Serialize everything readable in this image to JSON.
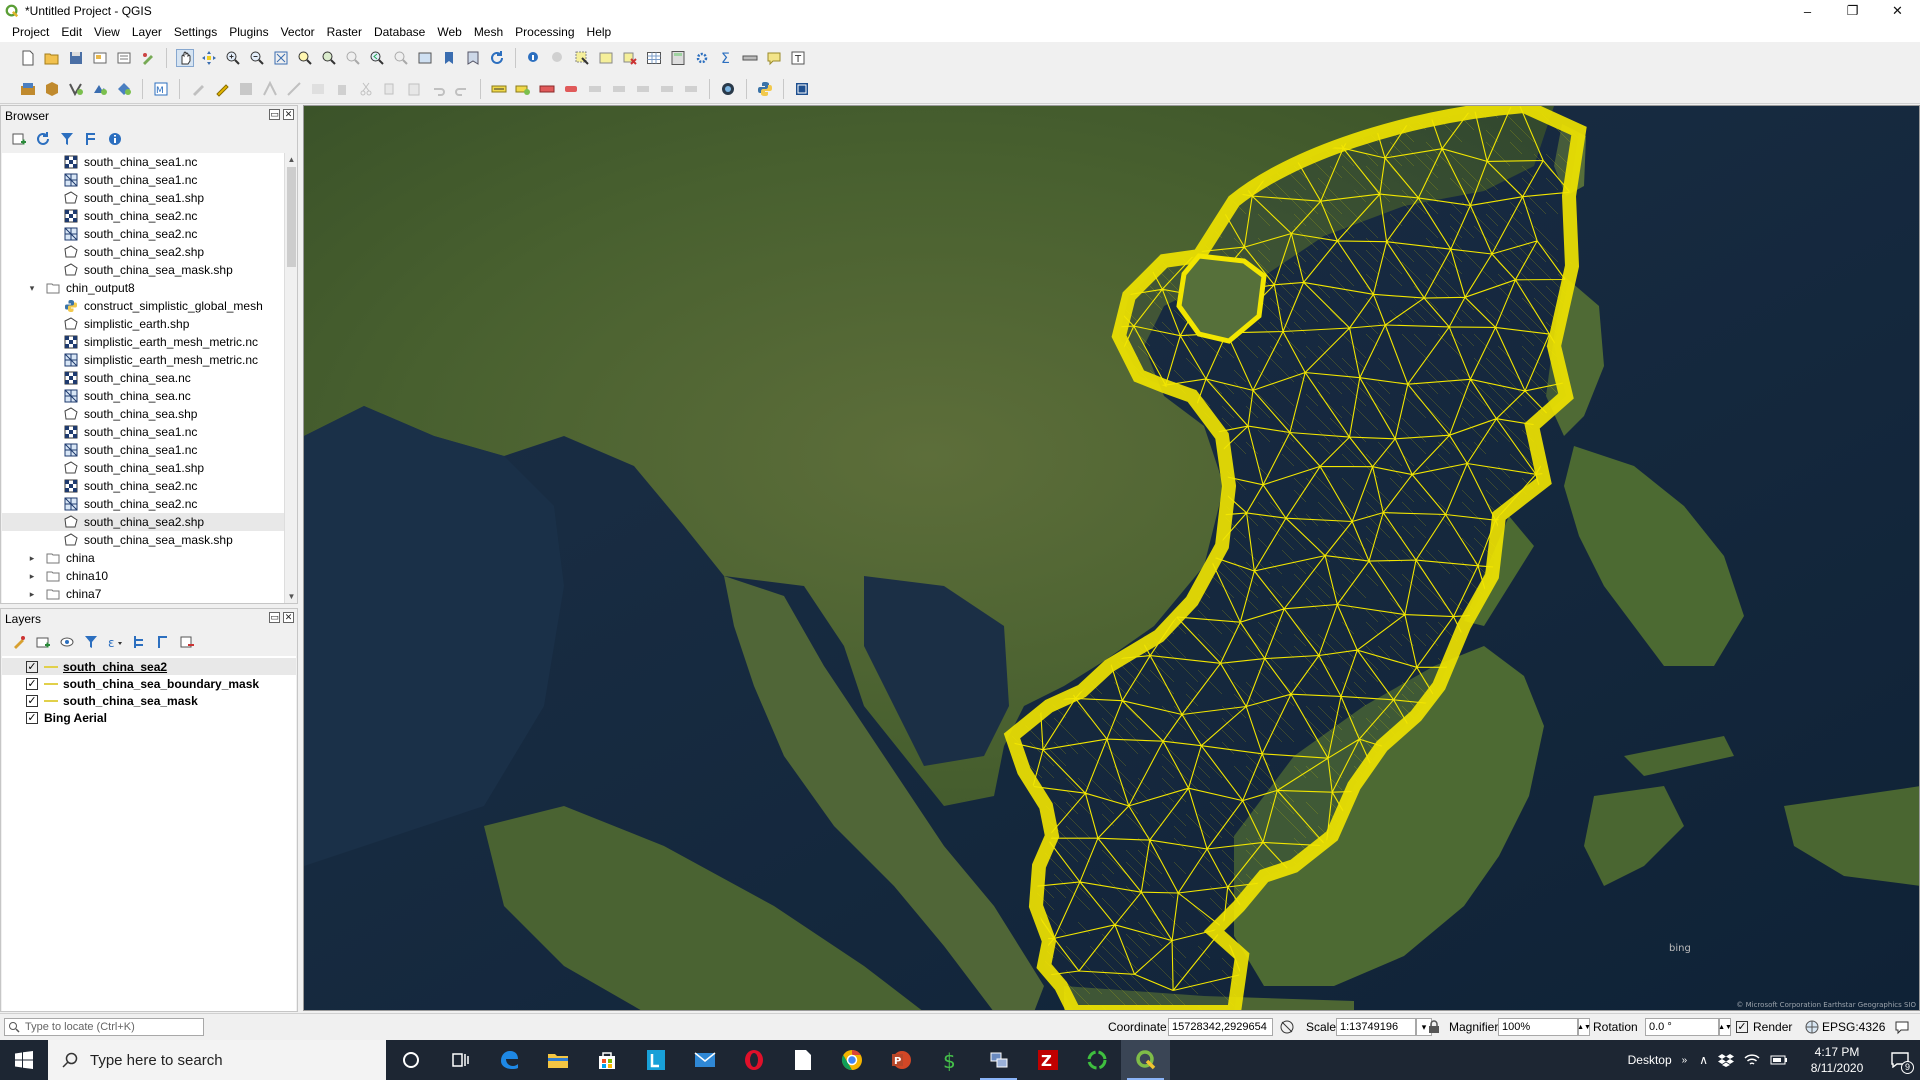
{
  "window": {
    "title": "*Untitled Project - QGIS",
    "minimize": "–",
    "maximize": "❐",
    "close": "✕"
  },
  "menu": [
    "Project",
    "Edit",
    "View",
    "Layer",
    "Settings",
    "Plugins",
    "Vector",
    "Raster",
    "Database",
    "Web",
    "Mesh",
    "Processing",
    "Help"
  ],
  "browser": {
    "title": "Browser",
    "items": [
      {
        "label": "south_china_sea1.nc",
        "icon": "raster-grid-icon",
        "expand": ""
      },
      {
        "label": "south_china_sea1.nc",
        "icon": "mesh-icon",
        "expand": ""
      },
      {
        "label": "south_china_sea1.shp",
        "icon": "polygon-layer-icon",
        "expand": ""
      },
      {
        "label": "south_china_sea2.nc",
        "icon": "raster-grid-icon",
        "expand": ""
      },
      {
        "label": "south_china_sea2.nc",
        "icon": "mesh-icon",
        "expand": ""
      },
      {
        "label": "south_china_sea2.shp",
        "icon": "polygon-layer-icon",
        "expand": ""
      },
      {
        "label": "south_china_sea_mask.shp",
        "icon": "polygon-layer-icon",
        "expand": ""
      },
      {
        "label": "chin_output8",
        "icon": "folder-icon",
        "expand": "▾"
      },
      {
        "label": "construct_simplistic_global_mesh",
        "icon": "python-file-icon",
        "expand": ""
      },
      {
        "label": "simplistic_earth.shp",
        "icon": "polygon-layer-icon",
        "expand": ""
      },
      {
        "label": "simplistic_earth_mesh_metric.nc",
        "icon": "raster-grid-icon",
        "expand": ""
      },
      {
        "label": "simplistic_earth_mesh_metric.nc",
        "icon": "mesh-icon",
        "expand": ""
      },
      {
        "label": "south_china_sea.nc",
        "icon": "raster-grid-icon",
        "expand": ""
      },
      {
        "label": "south_china_sea.nc",
        "icon": "mesh-icon",
        "expand": ""
      },
      {
        "label": "south_china_sea.shp",
        "icon": "polygon-layer-icon",
        "expand": ""
      },
      {
        "label": "south_china_sea1.nc",
        "icon": "raster-grid-icon",
        "expand": ""
      },
      {
        "label": "south_china_sea1.nc",
        "icon": "mesh-icon",
        "expand": ""
      },
      {
        "label": "south_china_sea1.shp",
        "icon": "polygon-layer-icon",
        "expand": ""
      },
      {
        "label": "south_china_sea2.nc",
        "icon": "raster-grid-icon",
        "expand": ""
      },
      {
        "label": "south_china_sea2.nc",
        "icon": "mesh-icon",
        "expand": ""
      },
      {
        "label": "south_china_sea2.shp",
        "icon": "polygon-layer-icon",
        "expand": "",
        "selected": true
      },
      {
        "label": "south_china_sea_mask.shp",
        "icon": "polygon-layer-icon",
        "expand": ""
      },
      {
        "label": "china",
        "icon": "folder-icon",
        "expand": "▸"
      },
      {
        "label": "china10",
        "icon": "folder-icon",
        "expand": "▸"
      },
      {
        "label": "china7",
        "icon": "folder-icon",
        "expand": "▸"
      }
    ]
  },
  "layers": {
    "title": "Layers",
    "items": [
      {
        "label": "south_china_sea2",
        "checked": true,
        "symbol": true,
        "underline": true
      },
      {
        "label": "south_china_sea_boundary_mask",
        "checked": true,
        "symbol": true,
        "underline": false
      },
      {
        "label": "south_china_sea_mask",
        "checked": true,
        "symbol": true,
        "underline": false
      },
      {
        "label": "Bing Aerial",
        "checked": true,
        "symbol": false,
        "underline": false
      }
    ]
  },
  "map": {
    "attribution": "© Microsoft Corporation Earthstar Geographics SIO",
    "logo": "bing",
    "mesh_color": "#f2e600"
  },
  "status": {
    "locate_placeholder": "Type to locate (Ctrl+K)",
    "coordinate_label": "Coordinate",
    "coordinate_value": "15728342,2929654",
    "scale_label": "Scale",
    "scale_value": "1:13749196",
    "magnifier_label": "Magnifier",
    "magnifier_value": "100%",
    "rotation_label": "Rotation",
    "rotation_value": "0.0 °",
    "render_label": "Render",
    "crs_label": "EPSG:4326"
  },
  "taskbar": {
    "search_placeholder": "Type here to search",
    "desktop_label": "Desktop",
    "time": "4:17 PM",
    "date": "8/11/2020",
    "notification_count": "9"
  }
}
